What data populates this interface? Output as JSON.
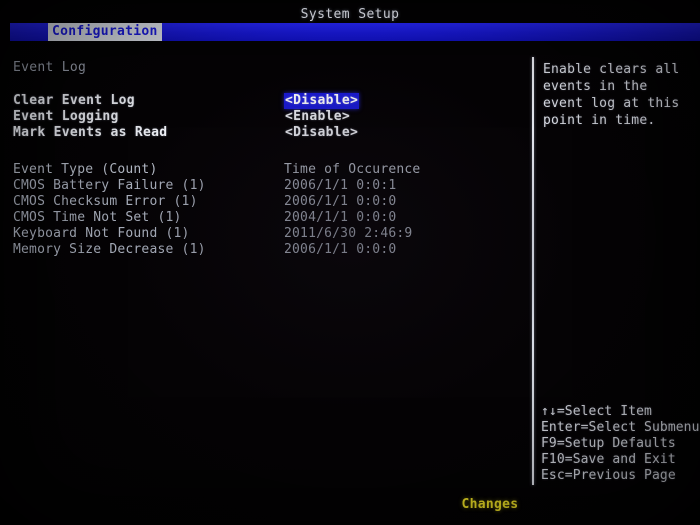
{
  "screen": {
    "title": "System Setup",
    "background_color": "#050305",
    "accent_color": "#1a1ad6",
    "status_color": "#f2e426"
  },
  "menubar": {
    "active_tab": "Configuration"
  },
  "left": {
    "section_heading": "Event Log",
    "options": [
      {
        "label": "Clear Event Log",
        "value": "<Disable>",
        "selected": true
      },
      {
        "label": "Event Logging",
        "value": "<Enable>",
        "selected": false
      },
      {
        "label": "Mark Events as Read",
        "value": "<Disable>",
        "selected": false
      }
    ],
    "event_table": {
      "headers": {
        "type": "Event Type (Count)",
        "time": "Time of Occurence"
      },
      "rows": [
        {
          "type": "CMOS Battery Failure (1)",
          "time": "2006/1/1 0:0:1"
        },
        {
          "type": "CMOS Checksum Error (1)",
          "time": "2006/1/1 0:0:0"
        },
        {
          "type": "CMOS Time Not Set (1)",
          "time": "2004/1/1 0:0:0"
        },
        {
          "type": "Keyboard Not Found (1)",
          "time": "2011/6/30 2:46:9"
        },
        {
          "type": "Memory Size Decrease (1)",
          "time": "2006/1/1 0:0:0"
        }
      ]
    }
  },
  "right": {
    "help_text": "Enable clears all events in the event log at this point in time.",
    "key_legend": [
      "↑↓=Select Item",
      "Enter=Select Submenu",
      "F9=Setup Defaults",
      "F10=Save and Exit",
      "Esc=Previous Page"
    ]
  },
  "status": {
    "text": "Changes"
  }
}
